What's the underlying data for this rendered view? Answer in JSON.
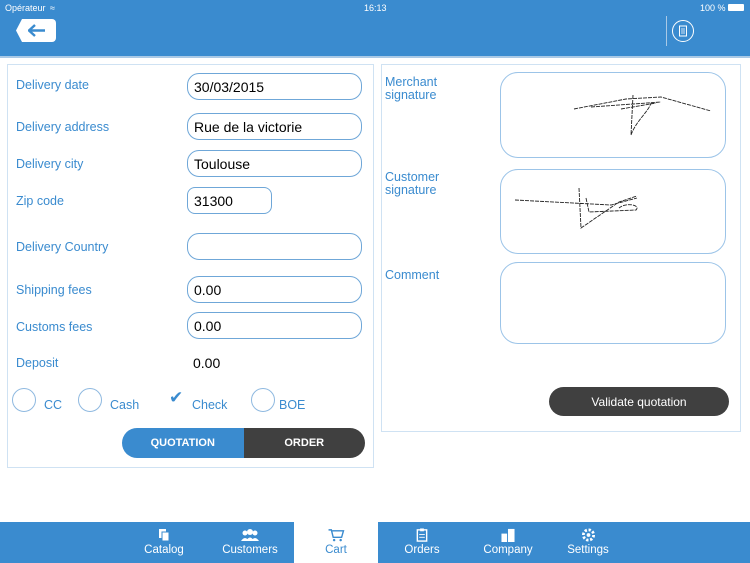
{
  "status_bar": {
    "carrier": "Opérateur",
    "time": "16:13",
    "battery": "100 %"
  },
  "nav": {
    "back_icon": "back-arrow-icon",
    "doc_icon": "document-icon"
  },
  "form": {
    "fields": [
      {
        "label": "Delivery date",
        "value": "30/03/2015"
      },
      {
        "label": "Delivery address",
        "value": "Rue  de la victorie"
      },
      {
        "label": "Delivery city",
        "value": "Toulouse"
      },
      {
        "label": "Zip code",
        "value": "31300"
      },
      {
        "label": "Delivery Country",
        "value": ""
      },
      {
        "label": "Shipping fees",
        "value": "0.00"
      },
      {
        "label": "Customs fees",
        "value": "0.00"
      },
      {
        "label": "Deposit",
        "value": "0.00"
      }
    ],
    "payment_methods": [
      {
        "label": "CC",
        "checked": false
      },
      {
        "label": "Cash",
        "checked": false
      },
      {
        "label": "Check",
        "checked": true
      },
      {
        "label": "BOE",
        "checked": false
      }
    ],
    "segment": {
      "quotation": "QUOTATION",
      "order": "ORDER",
      "selected": "QUOTATION"
    }
  },
  "right": {
    "merchant_signature_label": "Merchant signature",
    "customer_signature_label": "Customer signature",
    "comment_label": "Comment",
    "comment_value": "",
    "validate_label": "Validate quotation"
  },
  "tabs": [
    {
      "label": "Catalog",
      "icon": "catalog-icon"
    },
    {
      "label": "Customers",
      "icon": "customers-icon"
    },
    {
      "label": "Cart",
      "icon": "cart-icon",
      "active": true
    },
    {
      "label": "Orders",
      "icon": "orders-icon"
    },
    {
      "label": "Company",
      "icon": "company-icon"
    },
    {
      "label": "Settings",
      "icon": "settings-icon"
    }
  ],
  "colors": {
    "primary": "#3a8bcf",
    "dark": "#404040"
  }
}
